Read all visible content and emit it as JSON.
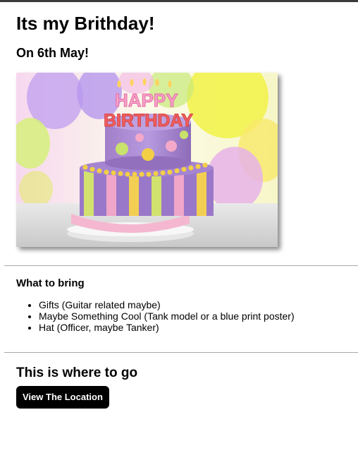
{
  "page": {
    "title": "Its my Brithday!",
    "subtitle": "On 6th May!"
  },
  "image": {
    "alt": "Birthday cake with candles spelling HAPPY BIRTHDAY",
    "candle_line1": "HAPPY",
    "candle_line2": "BIRTHDAY"
  },
  "bring": {
    "heading": "What to bring",
    "items": [
      "Gifts (Guitar related maybe)",
      "Maybe Something Cool (Tank model or a blue print poster)",
      "Hat (Officer, maybe Tanker)"
    ]
  },
  "location": {
    "heading": "This is where to go",
    "button_label": "View The Location"
  },
  "colors": {
    "button_bg": "#000000",
    "button_text": "#ffffff",
    "divider": "#a8a8a8"
  }
}
